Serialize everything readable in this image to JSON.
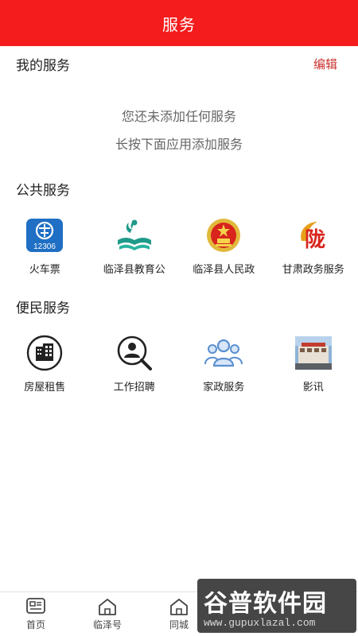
{
  "header": {
    "title": "服务"
  },
  "my_services": {
    "title": "我的服务",
    "edit_label": "编辑",
    "empty_line1": "您还未添加任何服务",
    "empty_line2": "长按下面应用添加服务"
  },
  "public_services": {
    "title": "公共服务",
    "items": [
      {
        "label": "火车票",
        "icon": "railway-12306-icon",
        "icon_text": "12306"
      },
      {
        "label": "临泽县教育公",
        "icon": "education-book-icon"
      },
      {
        "label": "临泽县人民政",
        "icon": "national-emblem-icon"
      },
      {
        "label": "甘肃政务服务",
        "icon": "gansu-gov-logo-icon",
        "icon_text": "陇"
      }
    ]
  },
  "convenience_services": {
    "title": "便民服务",
    "items": [
      {
        "label": "房屋租售",
        "icon": "building-icon"
      },
      {
        "label": "工作招聘",
        "icon": "person-search-icon"
      },
      {
        "label": "家政服务",
        "icon": "people-group-icon"
      },
      {
        "label": "影讯",
        "icon": "cinema-photo-icon"
      }
    ]
  },
  "bottom_nav": {
    "items": [
      {
        "label": "首页",
        "icon": "news-card-icon"
      },
      {
        "label": "临泽号",
        "icon": "house-icon"
      },
      {
        "label": "同城",
        "icon": "house-icon"
      }
    ]
  },
  "watermark": {
    "main": "谷普软件园",
    "sub": "www.gupuxlazal.com"
  },
  "colors": {
    "accent": "#f41c1c",
    "edit": "#c9302c",
    "railway_blue": "#1f6fc4",
    "edu_teal": "#1f9a8a",
    "gov_red": "#d8241c"
  }
}
